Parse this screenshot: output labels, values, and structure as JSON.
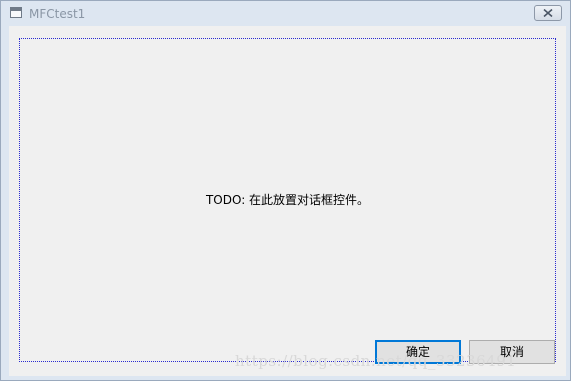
{
  "window": {
    "title": "MFCtest1"
  },
  "dialog": {
    "placeholder_text": "TODO: 在此放置对话框控件。",
    "ok_label": "确定",
    "cancel_label": "取消"
  },
  "watermark": {
    "text": "https://blog.csdn.net/qq_33236491"
  },
  "icons": {
    "app": "window-app-icon",
    "close": "close-icon"
  },
  "colors": {
    "focus_border": "#0078d7",
    "focus_rect": "#2b2bd0",
    "dialog_bg": "#f0f0f0",
    "frame_bg": "#dde6f1"
  }
}
